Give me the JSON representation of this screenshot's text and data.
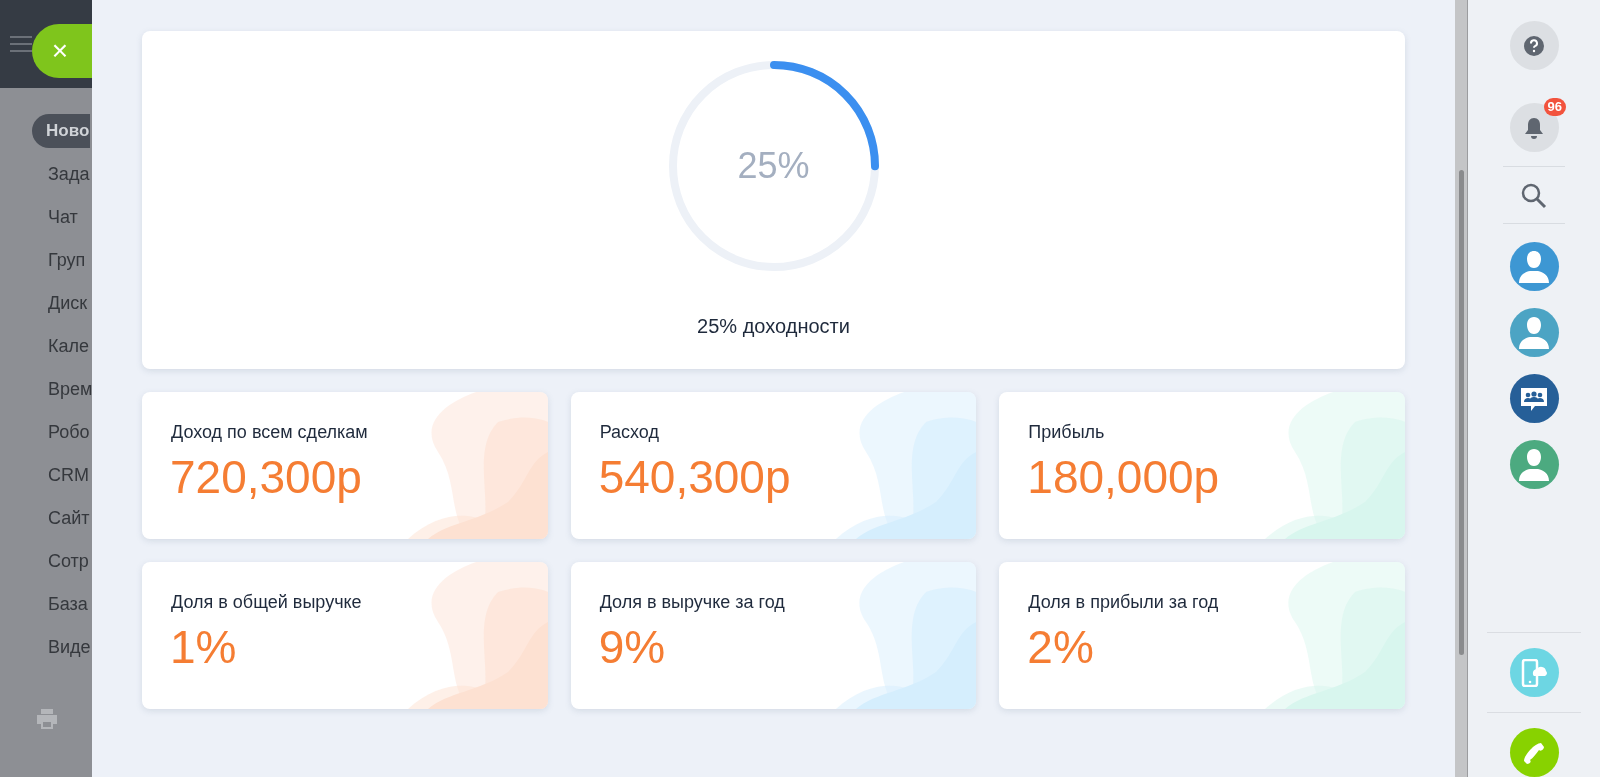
{
  "left_menu": {
    "items": [
      {
        "label": "Ново",
        "selected": true
      },
      {
        "label": "Зада",
        "selected": false
      },
      {
        "label": "Чат",
        "selected": false
      },
      {
        "label": "Груп",
        "selected": false
      },
      {
        "label": "Диск",
        "selected": false
      },
      {
        "label": "Кале",
        "selected": false
      },
      {
        "label": "Врем",
        "selected": false
      },
      {
        "label": "Робо",
        "selected": false
      },
      {
        "label": "CRM",
        "selected": false
      },
      {
        "label": "Сайт",
        "selected": false
      },
      {
        "label": "Сотр",
        "selected": false
      },
      {
        "label": "База",
        "selected": false
      },
      {
        "label": "Виде",
        "selected": false
      }
    ]
  },
  "close_button": {
    "label": "×"
  },
  "progress": {
    "reading": "25%",
    "level": 0.25,
    "caption": "25% доходности"
  },
  "stats": [
    {
      "label": "Доход по всем сделкам",
      "value": "720,300р",
      "color": "#fde1d2"
    },
    {
      "label": "Расход",
      "value": "540,300р",
      "color": "#d5eefd"
    },
    {
      "label": "Прибыль",
      "value": "180,000р",
      "color": "#d8f6ee"
    },
    {
      "label": "Доля в общей выручке",
      "value": "1%",
      "color": "#fde1d2"
    },
    {
      "label": "Доля в выручке за год",
      "value": "9%",
      "color": "#d5eefd"
    },
    {
      "label": "Доля в прибыли за год",
      "value": "2%",
      "color": "#d8f6ee"
    }
  ],
  "right_bar": {
    "notifications_badge": "96",
    "contacts": [
      {
        "kind": "person",
        "color": "#3d97d3"
      },
      {
        "kind": "person",
        "color": "#4ca4c4"
      },
      {
        "kind": "group",
        "color": "#265f98"
      },
      {
        "kind": "person",
        "color": "#4caa80"
      }
    ]
  }
}
